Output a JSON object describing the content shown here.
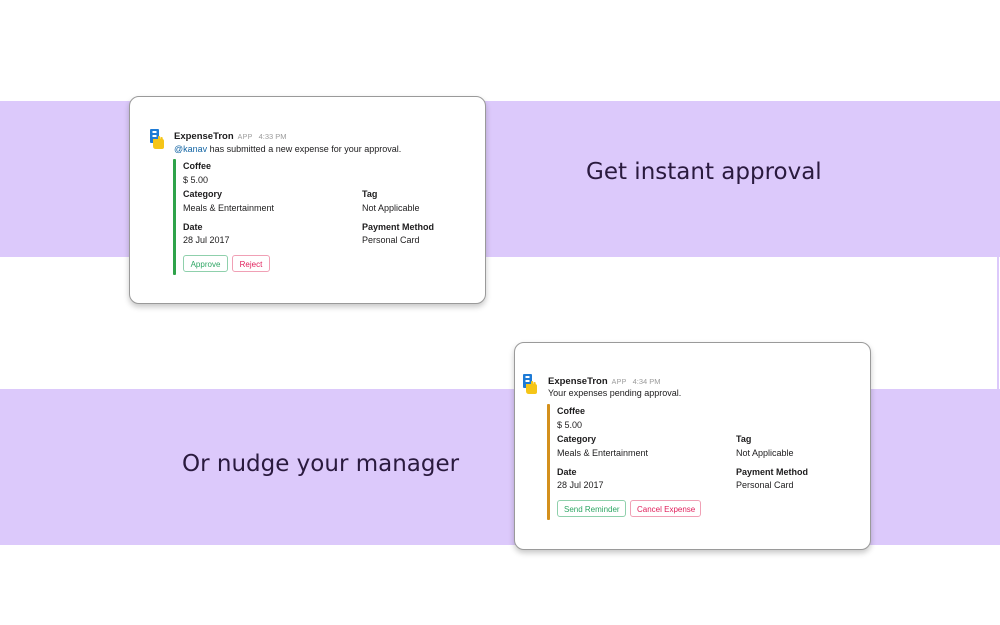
{
  "headlines": {
    "top": "Get instant approval",
    "bottom": "Or nudge your manager"
  },
  "colors": {
    "band": "#dcc9fb",
    "approve_green": "#2ea664",
    "reject_red": "#e01e5a",
    "bar_green": "#2fa34a",
    "bar_orange": "#d4901c",
    "mention_blue": "#1264a3"
  },
  "card_approval": {
    "app_name": "ExpenseTron",
    "badge": "APP",
    "time": "4:33 PM",
    "mention": "@kanav",
    "message": " has submitted a new expense for your approval.",
    "expense_title": "Coffee",
    "amount": "$ 5.00",
    "category_label": "Category",
    "category_value": "Meals & Entertainment",
    "tag_label": "Tag",
    "tag_value": "Not Applicable",
    "date_label": "Date",
    "date_value": "28 Jul 2017",
    "payment_label": "Payment Method",
    "payment_value": "Personal Card",
    "buttons": {
      "approve": "Approve",
      "reject": "Reject"
    }
  },
  "card_pending": {
    "app_name": "ExpenseTron",
    "badge": "APP",
    "time": "4:34 PM",
    "message": "Your expenses pending approval.",
    "expense_title": "Coffee",
    "amount": "$ 5.00",
    "category_label": "Category",
    "category_value": "Meals & Entertainment",
    "tag_label": "Tag",
    "tag_value": "Not Applicable",
    "date_label": "Date",
    "date_value": "28 Jul 2017",
    "payment_label": "Payment Method",
    "payment_value": "Personal Card",
    "buttons": {
      "remind": "Send Reminder",
      "cancel": "Cancel Expense"
    }
  },
  "icons": {
    "app_icon": "expensetron-hand-card-icon"
  }
}
